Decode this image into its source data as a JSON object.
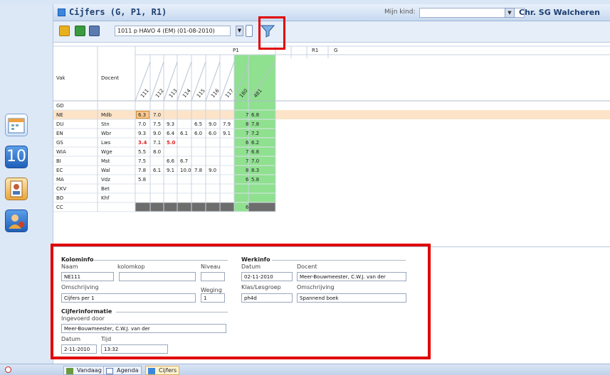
{
  "window": {
    "title": "Cijfers (G, P1, R1)",
    "mijn_kind_label": "Mijn kind:",
    "school": "Chr. SG Walcheren"
  },
  "toolbar": {
    "period": "1011 p HAVO 4 (EM) (01-08-2010)"
  },
  "table": {
    "header_vak": "Vak",
    "header_docent": "Docent",
    "group_p1": "P1",
    "group_r1": "R1",
    "group_g": "G",
    "columns": [
      "111",
      "112",
      "113",
      "114",
      "115",
      "116",
      "117",
      "180",
      "481"
    ],
    "rows": [
      {
        "vak": "GD",
        "docent": "",
        "grades": [
          "",
          "",
          "",
          "",
          "",
          "",
          "",
          "",
          ""
        ]
      },
      {
        "vak": "NE",
        "docent": "Mdb",
        "grades": [
          "6.3",
          "7.0",
          "",
          "",
          "",
          "",
          "",
          "7",
          "6.8"
        ]
      },
      {
        "vak": "DU",
        "docent": "Stn",
        "grades": [
          "7.0",
          "7.5",
          "9.3",
          "",
          "6.5",
          "9.0",
          "7.9",
          "8",
          "7.8"
        ]
      },
      {
        "vak": "EN",
        "docent": "Wbr",
        "grades": [
          "9.3",
          "9.0",
          "6.4",
          "6.1",
          "6.0",
          "6.0",
          "9.1",
          "7",
          "7.2"
        ]
      },
      {
        "vak": "GS",
        "docent": "Lws",
        "grades": [
          "3.4",
          "7.1",
          "5.0",
          "",
          "",
          "",
          "",
          "6",
          "6.2"
        ]
      },
      {
        "vak": "WIA",
        "docent": "Wge",
        "grades": [
          "5.5",
          "8.0",
          "",
          "",
          "",
          "",
          "",
          "7",
          "6.8"
        ]
      },
      {
        "vak": "BI",
        "docent": "Mst",
        "grades": [
          "7.5",
          "",
          "6.6",
          "6.7",
          "",
          "",
          "",
          "7",
          "7.0"
        ]
      },
      {
        "vak": "EC",
        "docent": "Wal",
        "grades": [
          "7.8",
          "6.1",
          "9.1",
          "10.0",
          "7.8",
          "9.0",
          "",
          "8",
          "8.3"
        ]
      },
      {
        "vak": "MA",
        "docent": "Vdz",
        "grades": [
          "5.8",
          "",
          "",
          "",
          "",
          "",
          "",
          "6",
          "5.8"
        ]
      },
      {
        "vak": "CKV",
        "docent": "Bet",
        "grades": [
          "",
          "",
          "",
          "",
          "",
          "",
          "",
          "",
          ""
        ]
      },
      {
        "vak": "BO",
        "docent": "Khf",
        "grades": [
          "",
          "",
          "",
          "",
          "",
          "",
          "",
          "",
          ""
        ]
      },
      {
        "vak": "CC",
        "docent": "",
        "grades": [
          "",
          "",
          "",
          "",
          "",
          "",
          "",
          "6",
          ""
        ]
      }
    ],
    "insufficient": [
      "3.4",
      "5.0"
    ],
    "colors": {
      "selected_row": "#fde4c8",
      "r1_column": "#8fe08f",
      "cc_bar": "#6d6d6d",
      "insufficient_text": "#e02020"
    }
  },
  "info": {
    "kolominfo_title": "Kolominfo",
    "naam_label": "Naam",
    "kolomkop_label": "kolomkop",
    "niveau_label": "Niveau",
    "naam_value": "NE111",
    "kolomkop_value": "",
    "niveau_value": "",
    "omschrijving_label": "Omschrijving",
    "weging_label": "Weging",
    "omschrijving_value": "Cijfers per 1",
    "weging_value": "1",
    "cijferinfo_title": "Cijferinformatie",
    "ingevoerd_label": "Ingevoerd door",
    "ingevoerd_value": "Meer-Bouwmeester, C.W.J. van der",
    "datum_label": "Datum",
    "tijd_label": "Tijd",
    "datum_value": "2-11-2010",
    "tijd_value": "13:32",
    "werkinfo_title": "Werkinfo",
    "w_datum_label": "Datum",
    "w_docent_label": "Docent",
    "w_datum_value": "02-11-2010",
    "w_docent_value": "Meer-Bouwmeester, C.W.J. van der",
    "klas_label": "Klas/Lesgroep",
    "w_omschrijving_label": "Omschrijving",
    "klas_value": "ph4d",
    "w_omschrijving_value": "Spannend boek"
  },
  "sidebar": {
    "icons": [
      "calendar-icon",
      "ten-icon",
      "id-card-icon",
      "user-settings-icon"
    ],
    "ten_label": "10"
  },
  "taskbar": {
    "tabs": [
      "Vandaag",
      "Agenda",
      "Cijfers"
    ],
    "active": "Cijfers"
  }
}
